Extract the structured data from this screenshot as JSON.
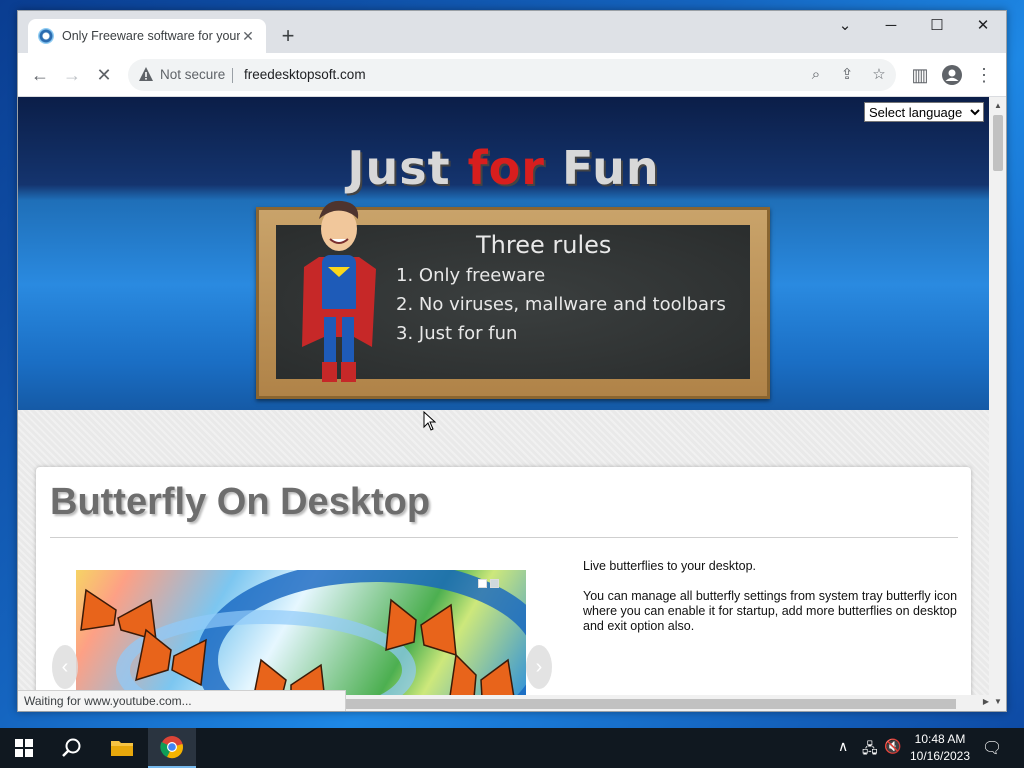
{
  "browser": {
    "tab_title": "Only Freeware software for your",
    "new_tab": "+",
    "not_secure": "Not secure",
    "url": "freedesktopsoft.com",
    "status_text": "Waiting for www.youtube.com..."
  },
  "page": {
    "language_select": "Select language",
    "banner": {
      "title_part1": "Just ",
      "title_part2": "for",
      "title_part3": " Fun",
      "board_heading": "Three rules",
      "rules": [
        "1. Only freeware",
        "2. No viruses, mallware and toolbars",
        "3. Just for fun"
      ]
    },
    "product": {
      "title": "Butterfly On Desktop",
      "description": [
        "Live butterflies to your desktop.",
        "You can manage all butterfly settings from system tray butterfly icon where you can enable it for startup, add more butterflies on desktop and exit option also."
      ]
    }
  },
  "taskbar": {
    "time": "10:48 AM",
    "date": "10/16/2023"
  },
  "colors": {
    "accent_red": "#d81e1e",
    "banner_dark": "#0b1e48",
    "banner_blue": "#2a8ae0",
    "taskbar": "#101820"
  }
}
